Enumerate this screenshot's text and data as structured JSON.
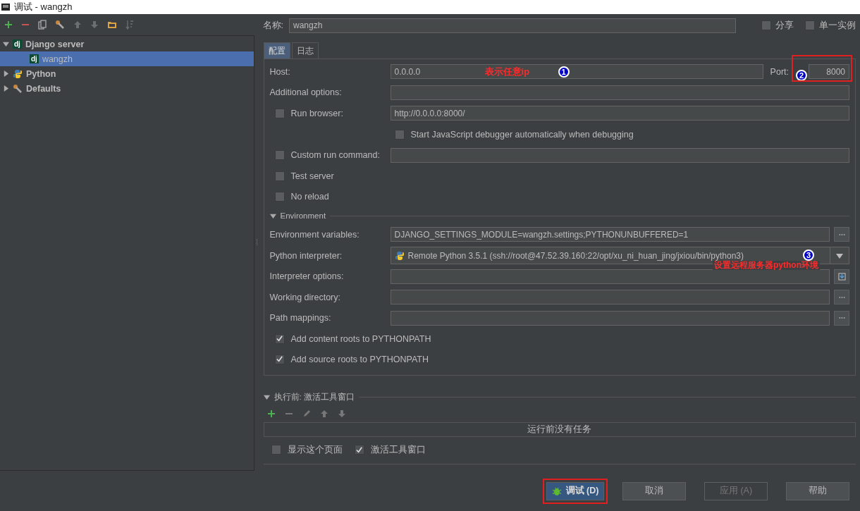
{
  "window": {
    "title": "调试 - wangzh"
  },
  "tree": [
    {
      "label": "Django server",
      "kind": "django",
      "badge": "dj",
      "expanded": true,
      "selected": false,
      "children": [
        {
          "label": "wangzh",
          "kind": "django",
          "badge": "dj",
          "selected": true
        }
      ]
    },
    {
      "label": "Python",
      "kind": "python",
      "expanded": false,
      "selected": false
    },
    {
      "label": "Defaults",
      "kind": "defaults",
      "expanded": false,
      "selected": false
    }
  ],
  "name_field": {
    "label": "名称:",
    "value": "wangzh"
  },
  "header_options": [
    {
      "label": "分享",
      "checked": false
    },
    {
      "label": "单一实例",
      "checked": false
    }
  ],
  "tabs": [
    {
      "label": "配置",
      "selected": true
    },
    {
      "label": "日志",
      "selected": false
    }
  ],
  "rows": [
    {
      "kind": "host",
      "label": "Host:",
      "value": "0.0.0.0",
      "note_number": "1",
      "note": "表示任意ip",
      "port_label": "Port:",
      "port_value": "8000",
      "port_number": "2"
    },
    {
      "kind": "field",
      "label": "Additional options:"
    },
    {
      "kind": "check-field",
      "label": "Run browser:",
      "checked": false,
      "value": "http://0.0.0.0:8000/"
    },
    {
      "kind": "sub-check",
      "label": "Start JavaScript debugger automatically when debugging",
      "checked": false
    },
    {
      "kind": "check-field",
      "label": "Custom run command:",
      "checked": false
    },
    {
      "kind": "check",
      "label": "Test server",
      "checked": false
    },
    {
      "kind": "check",
      "label": "No reload",
      "checked": false
    },
    {
      "kind": "section",
      "label": "Environment",
      "expanded": true
    },
    {
      "kind": "browse",
      "label": "Environment variables:",
      "value": "DJANGO_SETTINGS_MODULE=wangzh.settings;PYTHONUNBUFFERED=1"
    },
    {
      "kind": "interpreter",
      "label": "Python interpreter:",
      "value": "Remote Python 3.5.1 (ssh://root@47.52.39.160:22/opt/xu_ni_huan_jing/jxiou/bin/python3)",
      "note_number": "3",
      "note": "设置远程服务器python环境"
    },
    {
      "kind": "insert",
      "label": "Interpreter options:"
    },
    {
      "kind": "browse",
      "label": "Working directory:"
    },
    {
      "kind": "browse",
      "label": "Path mappings:"
    },
    {
      "kind": "check",
      "label": "Add content roots to PYTHONPATH",
      "checked": true
    },
    {
      "kind": "check",
      "label": "Add source roots to PYTHONPATH",
      "checked": true
    }
  ],
  "before_launch": {
    "title": "执行前: 激活工具窗口",
    "expanded": true,
    "empty_text": "运行前没有任务",
    "options": [
      {
        "label": "显示这个页面",
        "checked": false
      },
      {
        "label": "激活工具窗口",
        "checked": true
      }
    ]
  },
  "buttons": [
    {
      "label": "调试 (D)",
      "kind": "debug",
      "disabled": false,
      "highlighted": true
    },
    {
      "label": "取消",
      "kind": "plain",
      "disabled": false,
      "highlighted": false
    },
    {
      "label": "应用 (A)",
      "kind": "plain",
      "disabled": true,
      "highlighted": false
    },
    {
      "label": "帮助",
      "kind": "plain",
      "disabled": false,
      "highlighted": false
    }
  ]
}
